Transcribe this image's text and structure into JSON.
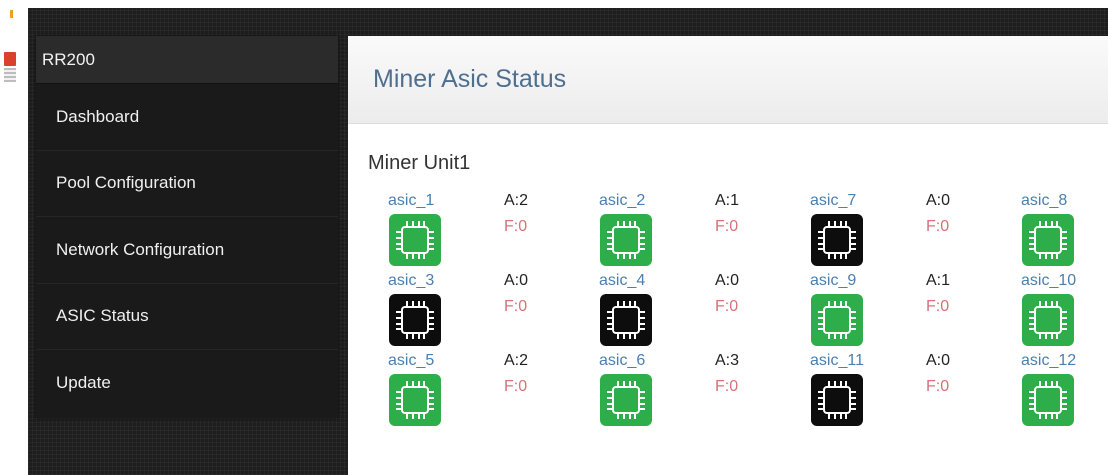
{
  "colors": {
    "chip_ok": "#2eae4a",
    "chip_bad": "#0d0d0d",
    "asic_link": "#4a7fb0",
    "fail_text": "#d9707a",
    "header_title": "#4f6f8f"
  },
  "sidebar": {
    "brand": "RR200",
    "items": [
      {
        "label": "Dashboard"
      },
      {
        "label": "Pool Configuration"
      },
      {
        "label": "Network Configuration"
      },
      {
        "label": "ASIC Status"
      },
      {
        "label": "Update"
      }
    ]
  },
  "main": {
    "title": "Miner Asic Status",
    "unit_title": "Miner Unit1",
    "asics": [
      {
        "name": "asic_1",
        "a": "A:2",
        "f": "F:0",
        "status": "ok",
        "icon": "chip-icon"
      },
      {
        "name": "asic_2",
        "a": "A:1",
        "f": "F:0",
        "status": "ok",
        "icon": "chip-icon"
      },
      {
        "name": "asic_7",
        "a": "A:0",
        "f": "F:0",
        "status": "bad",
        "icon": "chip-icon"
      },
      {
        "name": "asic_8",
        "a": "",
        "f": "",
        "status": "ok",
        "icon": "chip-icon"
      },
      {
        "name": "asic_3",
        "a": "A:0",
        "f": "F:0",
        "status": "bad",
        "icon": "chip-icon"
      },
      {
        "name": "asic_4",
        "a": "A:0",
        "f": "F:0",
        "status": "bad",
        "icon": "chip-icon"
      },
      {
        "name": "asic_9",
        "a": "A:1",
        "f": "F:0",
        "status": "ok",
        "icon": "chip-icon"
      },
      {
        "name": "asic_10",
        "a": "",
        "f": "",
        "status": "ok",
        "icon": "chip-icon"
      },
      {
        "name": "asic_5",
        "a": "A:2",
        "f": "F:0",
        "status": "ok",
        "icon": "chip-icon"
      },
      {
        "name": "asic_6",
        "a": "A:3",
        "f": "F:0",
        "status": "ok",
        "icon": "chip-icon"
      },
      {
        "name": "asic_11",
        "a": "A:0",
        "f": "F:0",
        "status": "bad",
        "icon": "chip-icon"
      },
      {
        "name": "asic_12",
        "a": "",
        "f": "",
        "status": "ok",
        "icon": "chip-icon"
      }
    ]
  }
}
